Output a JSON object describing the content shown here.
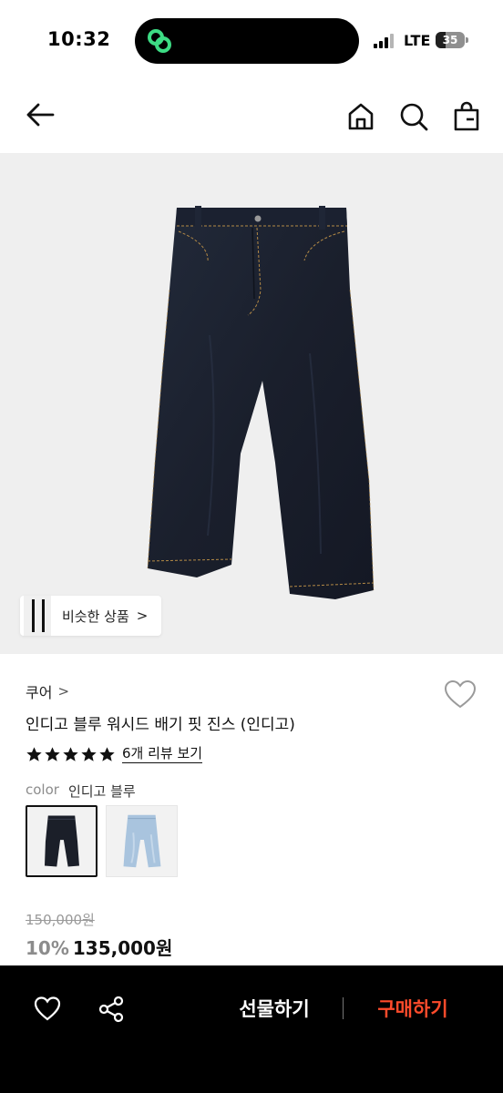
{
  "status_bar": {
    "time": "10:32",
    "network": "LTE",
    "battery": "35",
    "battery_level": 0.35,
    "island_app_icon": "link-rings-icon"
  },
  "nav": {
    "back_icon": "back-arrow-icon",
    "home_icon": "home-icon",
    "search_icon": "search-icon",
    "bag_icon": "shopping-bag-icon"
  },
  "hero": {
    "similar_label": "비슷한 상품",
    "similar_chevron": ">"
  },
  "product": {
    "brand": "쿠어",
    "brand_chevron": ">",
    "name": "인디고 블루 워시드 배기 핏 진스 (인디고)",
    "rating_stars": 5,
    "review_link": "6개 리뷰 보기",
    "color_label": "color",
    "color_value": "인디고 블루",
    "swatches": [
      "indigo",
      "light-blue"
    ],
    "original_price": "150,000원",
    "discount": "10%",
    "sale_price": "135,000원"
  },
  "bottom_bar": {
    "wishlist_icon": "heart-icon",
    "share_icon": "share-icon",
    "gift_label": "선물하기",
    "buy_label": "구매하기"
  },
  "colors": {
    "accent": "#ff4b2b",
    "indigo_denim": "#1c2230",
    "light_denim": "#a9c4de",
    "stitch": "#c8a050"
  }
}
